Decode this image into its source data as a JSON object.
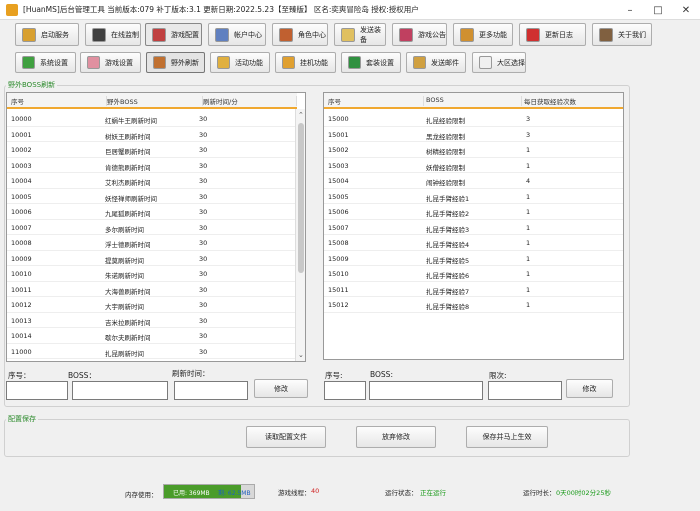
{
  "window": {
    "title": "[HuanMS]后台管理工具 当前版本:079 补丁版本:3.1 更新日期:2022.5.23【至臻版】 区名:奕爽冒险岛 授权:授权用户"
  },
  "toolbar1": [
    {
      "label": "启动服务",
      "icon": "launch-icon",
      "color": "#d8a030"
    },
    {
      "label": "在线监制",
      "icon": "monitor-icon",
      "color": "#404040"
    },
    {
      "label": "游戏配置",
      "icon": "game-config-icon",
      "color": "#c04040"
    },
    {
      "label": "帐户中心",
      "icon": "account-icon",
      "color": "#6080c0"
    },
    {
      "label": "角色中心",
      "icon": "role-icon",
      "color": "#c06030"
    },
    {
      "label": "发送装备",
      "icon": "send-equip-icon",
      "color": "#e0c060"
    },
    {
      "label": "游戏公告",
      "icon": "announce-icon",
      "color": "#c04060"
    },
    {
      "label": "更多功能",
      "icon": "more-icon",
      "color": "#d09030"
    },
    {
      "label": "更新日志",
      "icon": "log-icon",
      "color": "#d03030"
    },
    {
      "label": "关于我们",
      "icon": "about-icon",
      "color": "#806040"
    }
  ],
  "toolbar2": [
    {
      "label": "系统设置",
      "icon": "settings-icon",
      "color": "#40a040"
    },
    {
      "label": "游戏设置",
      "icon": "pig-icon",
      "color": "#e090a0"
    },
    {
      "label": "野外刷新",
      "icon": "monster-icon",
      "color": "#c07030"
    },
    {
      "label": "活动功能",
      "icon": "event-icon",
      "color": "#e0b040"
    },
    {
      "label": "挂机功能",
      "icon": "afk-icon",
      "color": "#e0a030"
    },
    {
      "label": "套装设置",
      "icon": "set-icon",
      "color": "#309040"
    },
    {
      "label": "发送邮件",
      "icon": "mail-icon",
      "color": "#d0a040"
    },
    {
      "label": "大区选择",
      "icon": "region-icon",
      "color": "#f0f0f0"
    }
  ],
  "boss_group": {
    "title": "野外BOSS刷新"
  },
  "left_table": {
    "headers": [
      "序号",
      "野外BOSS",
      "刷新时间/分"
    ],
    "rows": [
      [
        "10000",
        "红蜗牛王刷新时间",
        "30"
      ],
      [
        "10001",
        "树妖王刷新时间",
        "30"
      ],
      [
        "10002",
        "巨居蟹刷新时间",
        "30"
      ],
      [
        "10003",
        "肯德熊刷新时间",
        "30"
      ],
      [
        "10004",
        "艾利杰刷新时间",
        "30"
      ],
      [
        "10005",
        "妖怪禅师刷新时间",
        "30"
      ],
      [
        "10006",
        "九尾狐刷新时间",
        "30"
      ],
      [
        "10007",
        "多尔刷新时间",
        "30"
      ],
      [
        "10008",
        "浮士德刷新时间",
        "30"
      ],
      [
        "10009",
        "提莫刷新时间",
        "30"
      ],
      [
        "10010",
        "朱诺刷新时间",
        "30"
      ],
      [
        "10011",
        "大海兽刷新时间",
        "30"
      ],
      [
        "10012",
        "大宇刷新时间",
        "30"
      ],
      [
        "10013",
        "吉米拉刷新时间",
        "30"
      ],
      [
        "10014",
        "歇尔夫刷新时间",
        "30"
      ],
      [
        "11000",
        "扎昆刷新时间",
        "30"
      ]
    ]
  },
  "right_table": {
    "headers": [
      "序号",
      "BOSS",
      "每日获取经验次数"
    ],
    "rows": [
      [
        "15000",
        "扎昆经验限制",
        "3"
      ],
      [
        "15001",
        "黑龙经验限制",
        "3"
      ],
      [
        "15002",
        "树精经验限制",
        "1"
      ],
      [
        "15003",
        "妖僧经验限制",
        "1"
      ],
      [
        "15004",
        "闹钟经验限制",
        "4"
      ],
      [
        "15005",
        "扎昆手臂经验1",
        "1"
      ],
      [
        "15006",
        "扎昆手臂经验2",
        "1"
      ],
      [
        "15007",
        "扎昆手臂经验3",
        "1"
      ],
      [
        "15008",
        "扎昆手臂经验4",
        "1"
      ],
      [
        "15009",
        "扎昆手臂经验5",
        "1"
      ],
      [
        "15010",
        "扎昆手臂经验6",
        "1"
      ],
      [
        "15011",
        "扎昆手臂经验7",
        "1"
      ],
      [
        "15012",
        "扎昆手臂经验8",
        "1"
      ]
    ]
  },
  "left_form": {
    "id_label": "序号：",
    "boss_label": "BOSS：",
    "time_label": "刷新时间：",
    "edit_label": "修改",
    "id_value": "",
    "boss_value": "",
    "time_value": ""
  },
  "right_form": {
    "id_label": "序号:",
    "boss_label": "BOSS:",
    "count_label": "限次:",
    "edit_label": "修改",
    "id_value": "",
    "boss_value": "",
    "count_value": ""
  },
  "config_group": {
    "title": "配置保存",
    "read_label": "读取配置文件",
    "discard_label": "放弃修改",
    "save_label": "保存并马上生效"
  },
  "statusbar": {
    "memory_label": "内存使用：",
    "memory_used": "已用: 369MB",
    "memory_free": "剩: 62.5MB",
    "thread_label": "游戏线程：",
    "thread_value": "40",
    "run_label": "运行状态：",
    "run_value": "正在运行",
    "uptime_label": "运行时长：",
    "uptime_value": "0天00时02分25秒",
    "memory_percent": 0.85,
    "colors": {
      "ok": "#1a9a1a",
      "warn": "#d02020",
      "mem_bar": "#4a9c2a"
    }
  }
}
